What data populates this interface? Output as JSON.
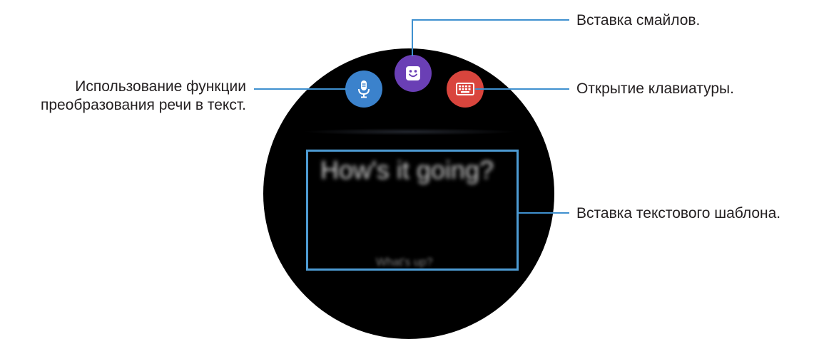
{
  "watch": {
    "template_main": "How's it going?",
    "template_sub": "What's up?"
  },
  "buttons": {
    "voice": {
      "icon": "microphone-icon",
      "color": "#3b82cc"
    },
    "emoji": {
      "icon": "smiley-icon",
      "color": "#6a3fb5"
    },
    "keyboard": {
      "icon": "keyboard-icon",
      "color": "#d9453d"
    }
  },
  "callouts": {
    "emoji": "Вставка смайлов.",
    "keyboard": "Открытие клавиатуры.",
    "voice_line1": "Использование функции",
    "voice_line2": "преобразования речи в текст.",
    "template": "Вставка текстового шаблона."
  },
  "accent_color": "#4d9bd3"
}
